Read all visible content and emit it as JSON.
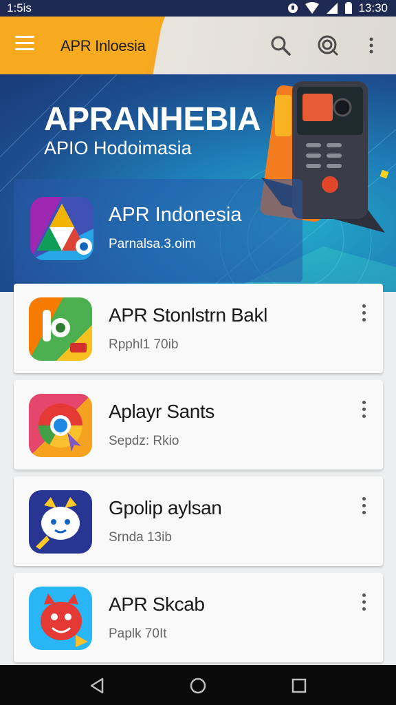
{
  "status_bar": {
    "time_left": "1:5is",
    "time_right": "13:30"
  },
  "app_bar": {
    "title": "APR Inloesia"
  },
  "hero": {
    "title": "APRANHEBIA",
    "subtitle": "APIO Hodoimasia",
    "featured": {
      "name": "APR Indonesia",
      "meta": "Parnalsa.3.oim"
    }
  },
  "apps": [
    {
      "title": "APR Stonlstrn Bakl",
      "meta": "Rpphl1 70ib"
    },
    {
      "title": "Aplayr Sants",
      "meta": "Sepdz: Rkio"
    },
    {
      "title": "Gpolip aylsan",
      "meta": "Srnda 13ib"
    },
    {
      "title": "APR Skcab",
      "meta": "Paplk 70It"
    }
  ],
  "colors": {
    "accent": "#f7a91f",
    "hero_blue": "#1d4e8f",
    "status_bar": "#1f2a52",
    "nav_bar": "#0a0a0a"
  },
  "icons": {
    "app_bar": [
      "menu-icon",
      "search-icon",
      "target-icon",
      "more-vert-icon"
    ],
    "nav": [
      "back-icon",
      "home-icon",
      "recents-icon"
    ]
  }
}
